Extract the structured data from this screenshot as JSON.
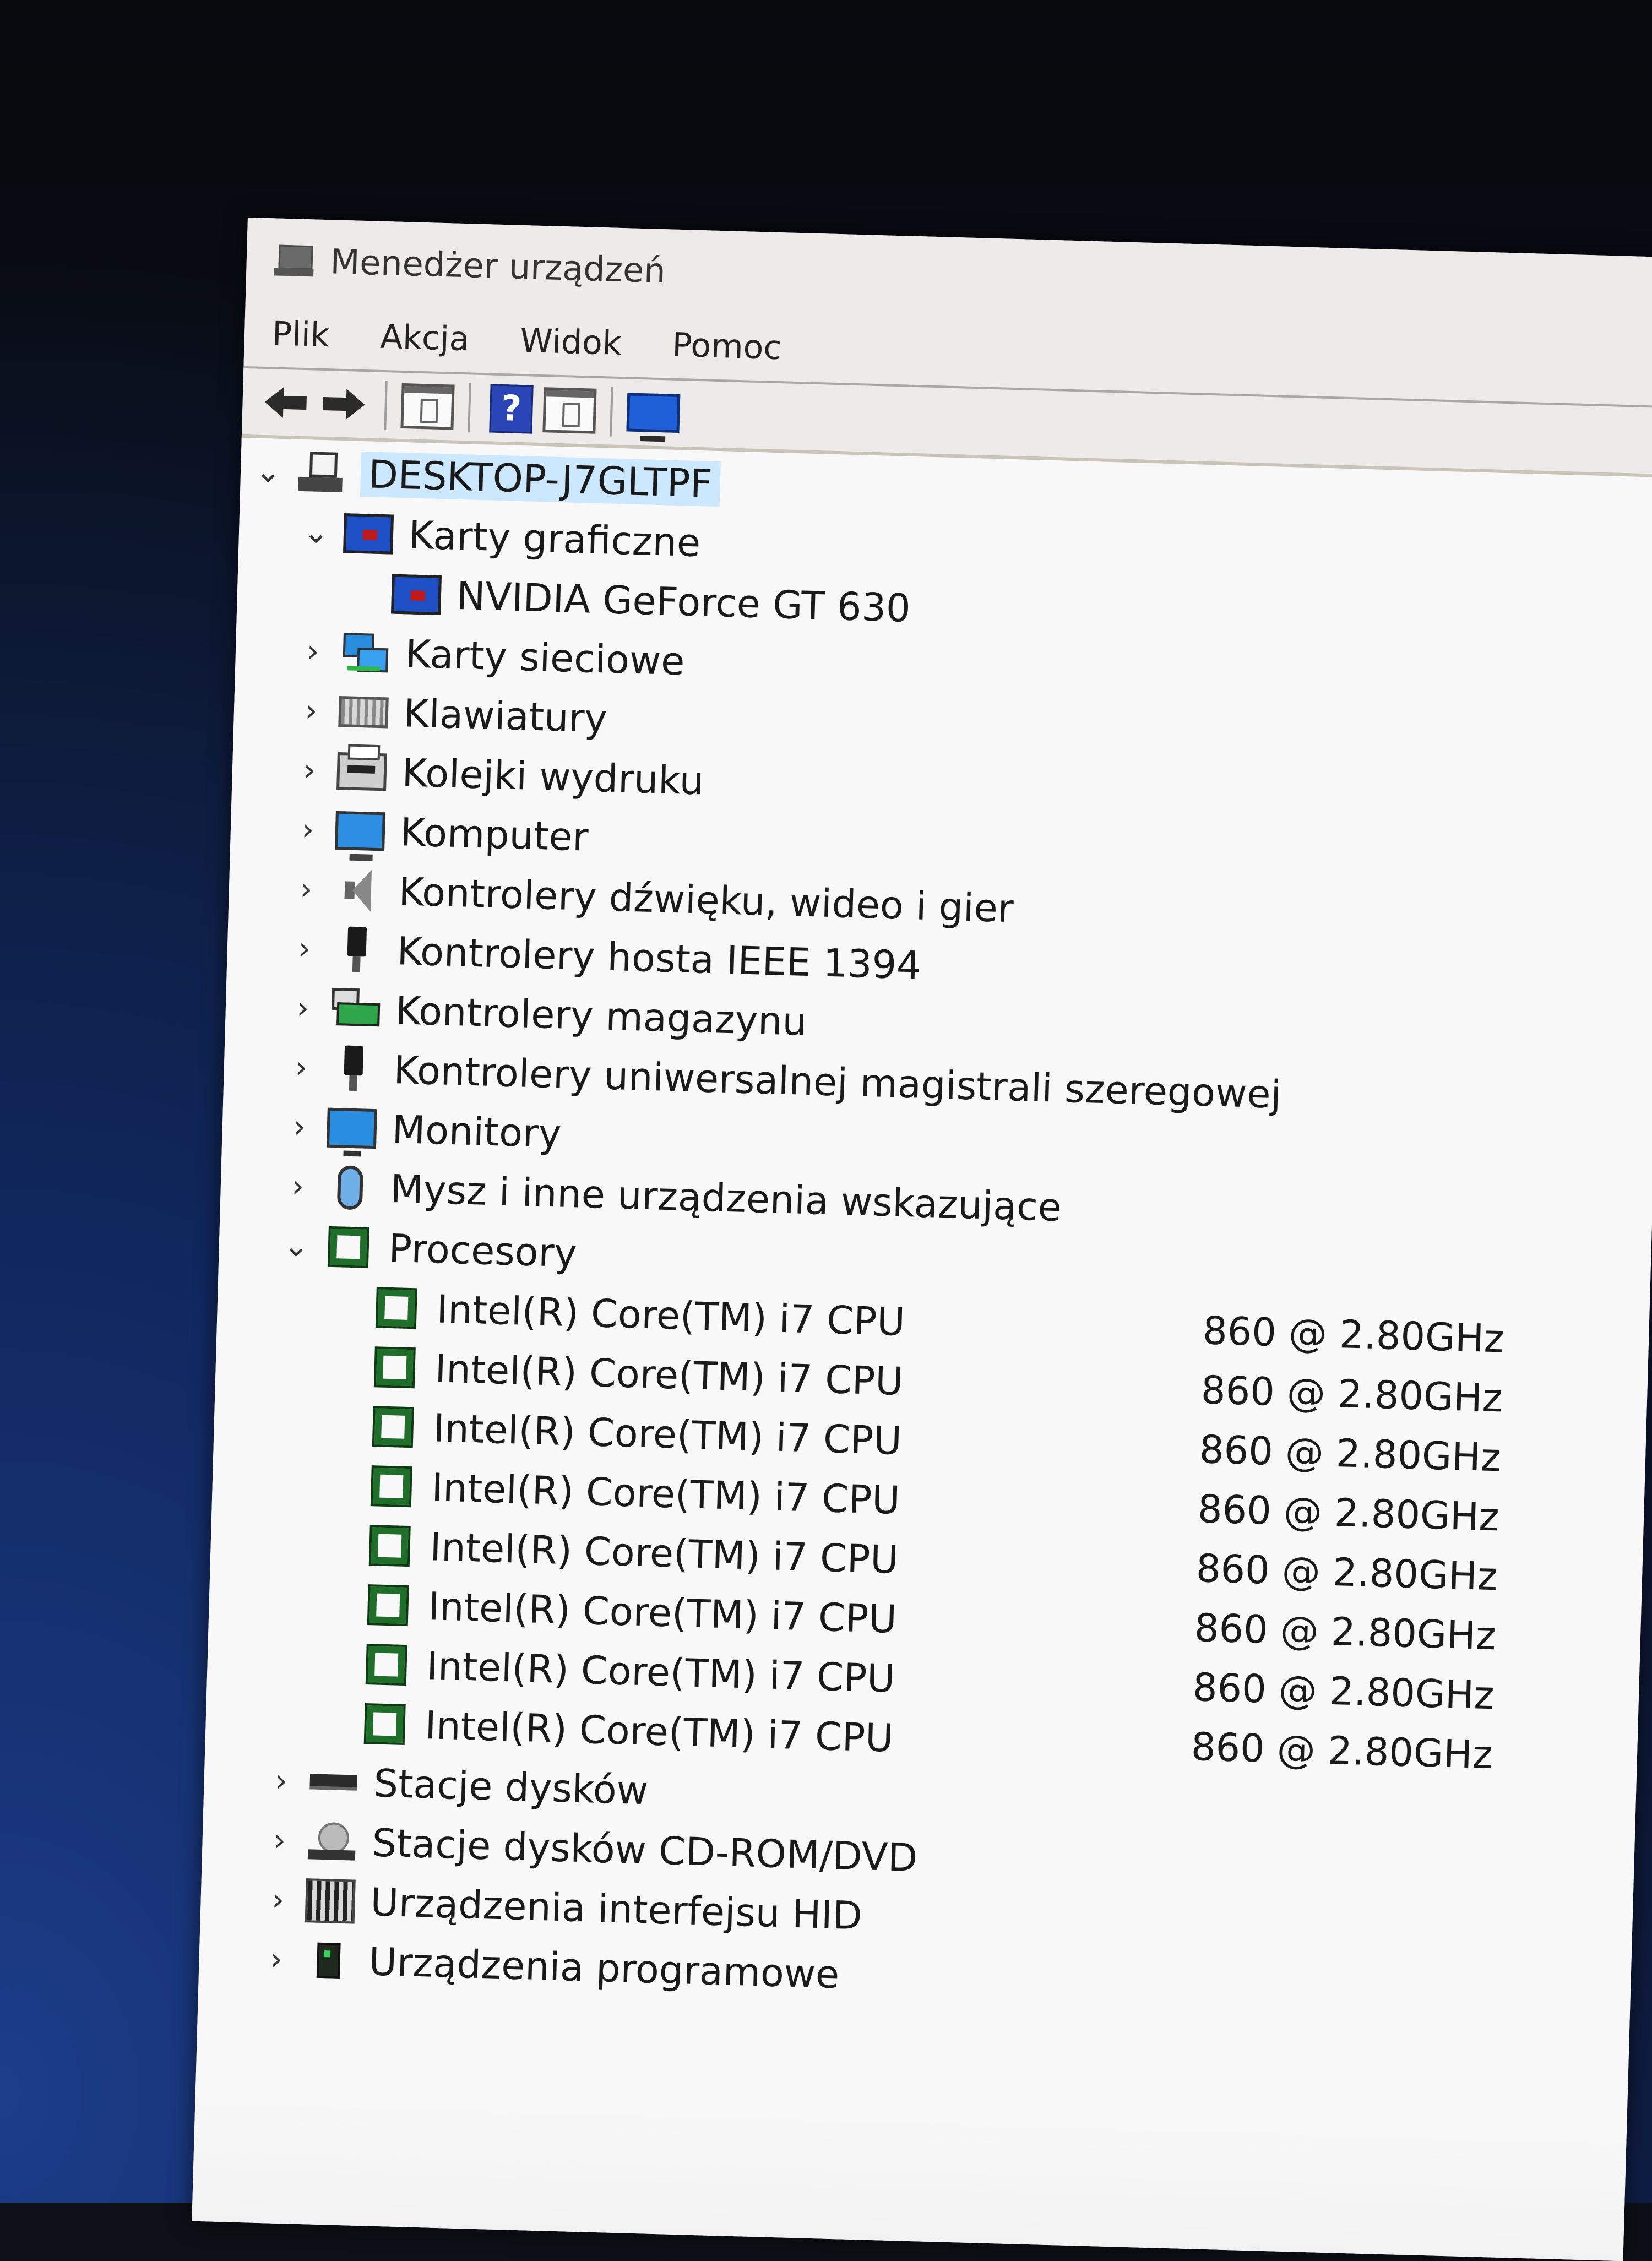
{
  "window": {
    "title": "Menedżer urządzeń",
    "icon": "device-manager-icon"
  },
  "menu": [
    "Plik",
    "Akcja",
    "Widok",
    "Pomoc"
  ],
  "toolbar": {
    "buttons": [
      "back-arrow-icon",
      "forward-arrow-icon",
      "properties-pane-icon",
      "help-icon",
      "show-pane-icon",
      "scan-hardware-icon"
    ],
    "help_glyph": "?"
  },
  "tree": {
    "root": "DESKTOP-J7GLTPF",
    "expanded_glyph": "⌄",
    "collapsed_glyph": "›",
    "categories": [
      {
        "label": "Karty graficzne",
        "expanded": true,
        "children": [
          "NVIDIA GeForce GT 630"
        ]
      },
      {
        "label": "Karty sieciowe",
        "expanded": false
      },
      {
        "label": "Klawiatury",
        "expanded": false
      },
      {
        "label": "Kolejki wydruku",
        "expanded": false
      },
      {
        "label": "Komputer",
        "expanded": false
      },
      {
        "label": "Kontrolery dźwięku, wideo i gier",
        "expanded": false
      },
      {
        "label": "Kontrolery hosta IEEE 1394",
        "expanded": false
      },
      {
        "label": "Kontrolery magazynu",
        "expanded": false
      },
      {
        "label": "Kontrolery uniwersalnej magistrali szeregowej",
        "expanded": false
      },
      {
        "label": "Monitory",
        "expanded": false
      },
      {
        "label": "Mysz i inne urządzenia wskazujące",
        "expanded": false
      },
      {
        "label": "Procesory",
        "expanded": true
      },
      {
        "label": "Stacje dysków",
        "expanded": false
      },
      {
        "label": "Stacje dysków CD-ROM/DVD",
        "expanded": false
      },
      {
        "label": "Urządzenia interfejsu HID",
        "expanded": false
      },
      {
        "label": "Urządzenia programowe",
        "expanded": false
      }
    ],
    "cpus": [
      {
        "name": "Intel(R) Core(TM) i7 CPU",
        "freq": "860  @ 2.80GHz"
      },
      {
        "name": "Intel(R) Core(TM) i7 CPU",
        "freq": "860  @ 2.80GHz"
      },
      {
        "name": "Intel(R) Core(TM) i7 CPU",
        "freq": "860  @ 2.80GHz"
      },
      {
        "name": "Intel(R) Core(TM) i7 CPU",
        "freq": "860  @ 2.80GHz"
      },
      {
        "name": "Intel(R) Core(TM) i7 CPU",
        "freq": "860  @ 2.80GHz"
      },
      {
        "name": "Intel(R) Core(TM) i7 CPU",
        "freq": "860  @ 2.80GHz"
      },
      {
        "name": "Intel(R) Core(TM) i7 CPU",
        "freq": "860  @ 2.80GHz"
      },
      {
        "name": "Intel(R) Core(TM) i7 CPU",
        "freq": "860  @ 2.80GHz"
      }
    ]
  },
  "colors": {
    "selection": "#cce8ff",
    "cpu_icon": "#1f6e2a"
  }
}
